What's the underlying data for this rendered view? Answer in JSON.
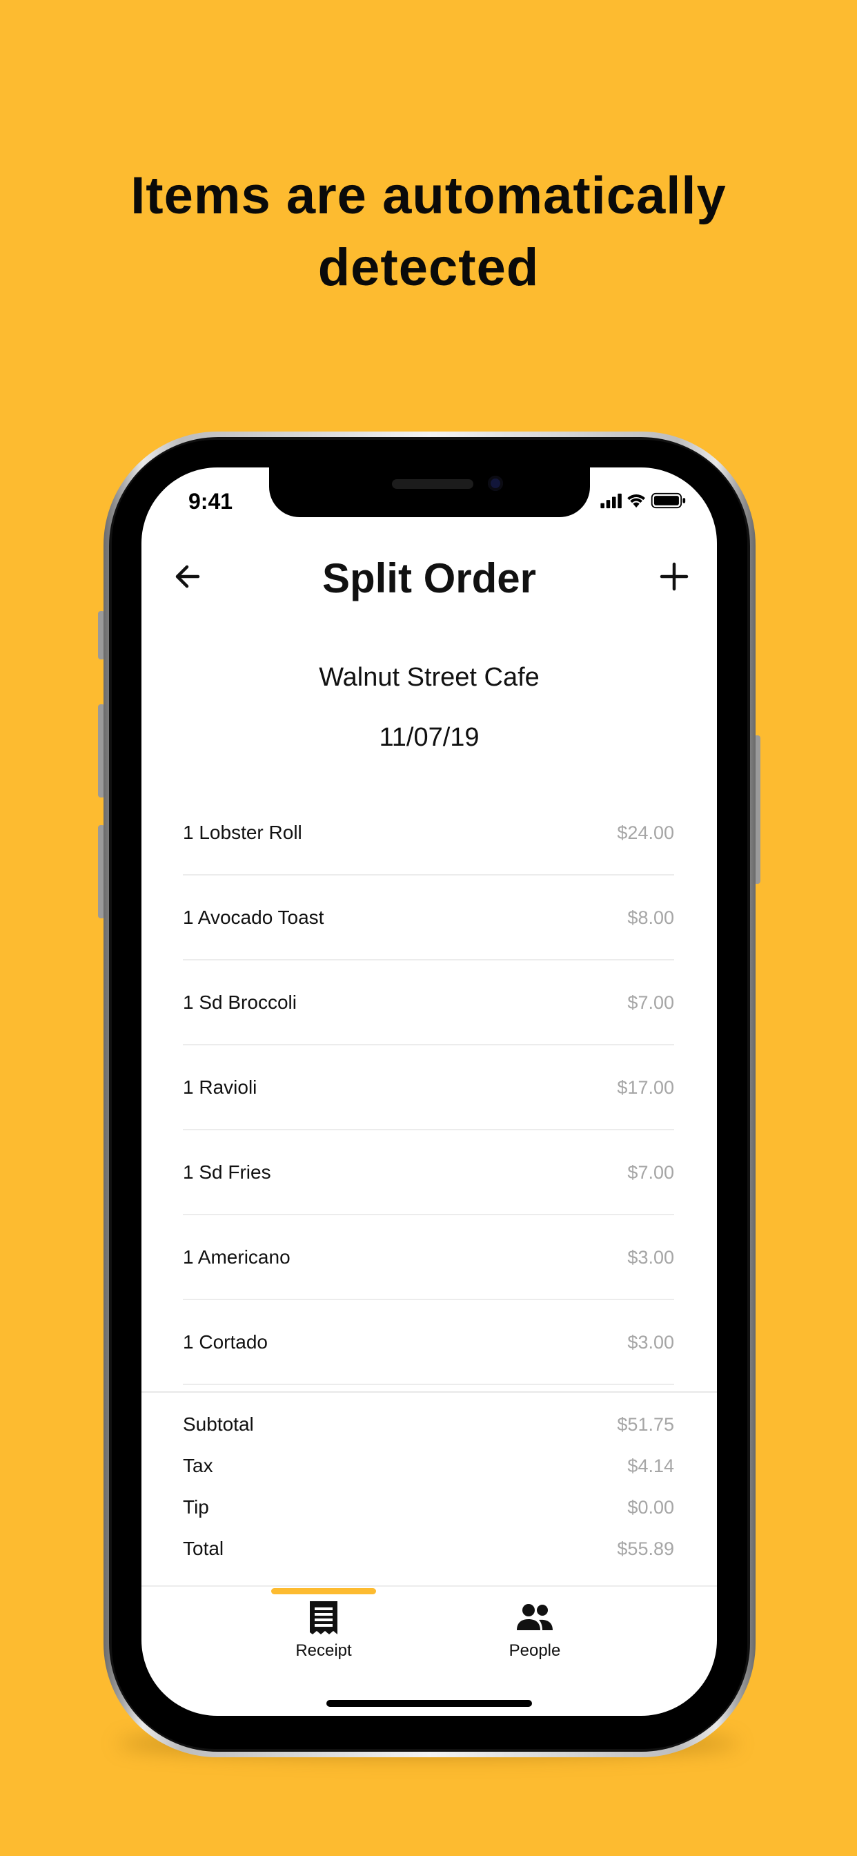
{
  "headline": {
    "line1": "Items are automatically",
    "line2": "detected"
  },
  "status_bar": {
    "time": "9:41",
    "icons": [
      "signal-icon",
      "wifi-icon",
      "battery-icon"
    ]
  },
  "nav": {
    "title": "Split Order",
    "back_icon": "arrow-left-icon",
    "add_icon": "plus-icon"
  },
  "receipt": {
    "restaurant": "Walnut Street Cafe",
    "date": "11/07/19",
    "items": [
      {
        "name": "1 Lobster Roll",
        "price": "$24.00"
      },
      {
        "name": "1 Avocado Toast",
        "price": "$8.00"
      },
      {
        "name": "1 Sd Broccoli",
        "price": "$7.00"
      },
      {
        "name": "1 Ravioli",
        "price": "$17.00"
      },
      {
        "name": "1 Sd Fries",
        "price": "$7.00"
      },
      {
        "name": "1 Americano",
        "price": "$3.00"
      },
      {
        "name": "1 Cortado",
        "price": "$3.00"
      }
    ],
    "totals": [
      {
        "label": "Subtotal",
        "value": "$51.75"
      },
      {
        "label": "Tax",
        "value": "$4.14"
      },
      {
        "label": "Tip",
        "value": "$0.00"
      },
      {
        "label": "Total",
        "value": "$55.89"
      }
    ]
  },
  "tabbar": {
    "tabs": [
      {
        "label": "Receipt",
        "icon": "receipt-icon",
        "active": true
      },
      {
        "label": "People",
        "icon": "people-icon",
        "active": false
      }
    ]
  },
  "colors": {
    "background": "#FDBB30",
    "accent": "#FDBB30",
    "price_text": "#A6A6A6",
    "primary_text": "#111111"
  }
}
